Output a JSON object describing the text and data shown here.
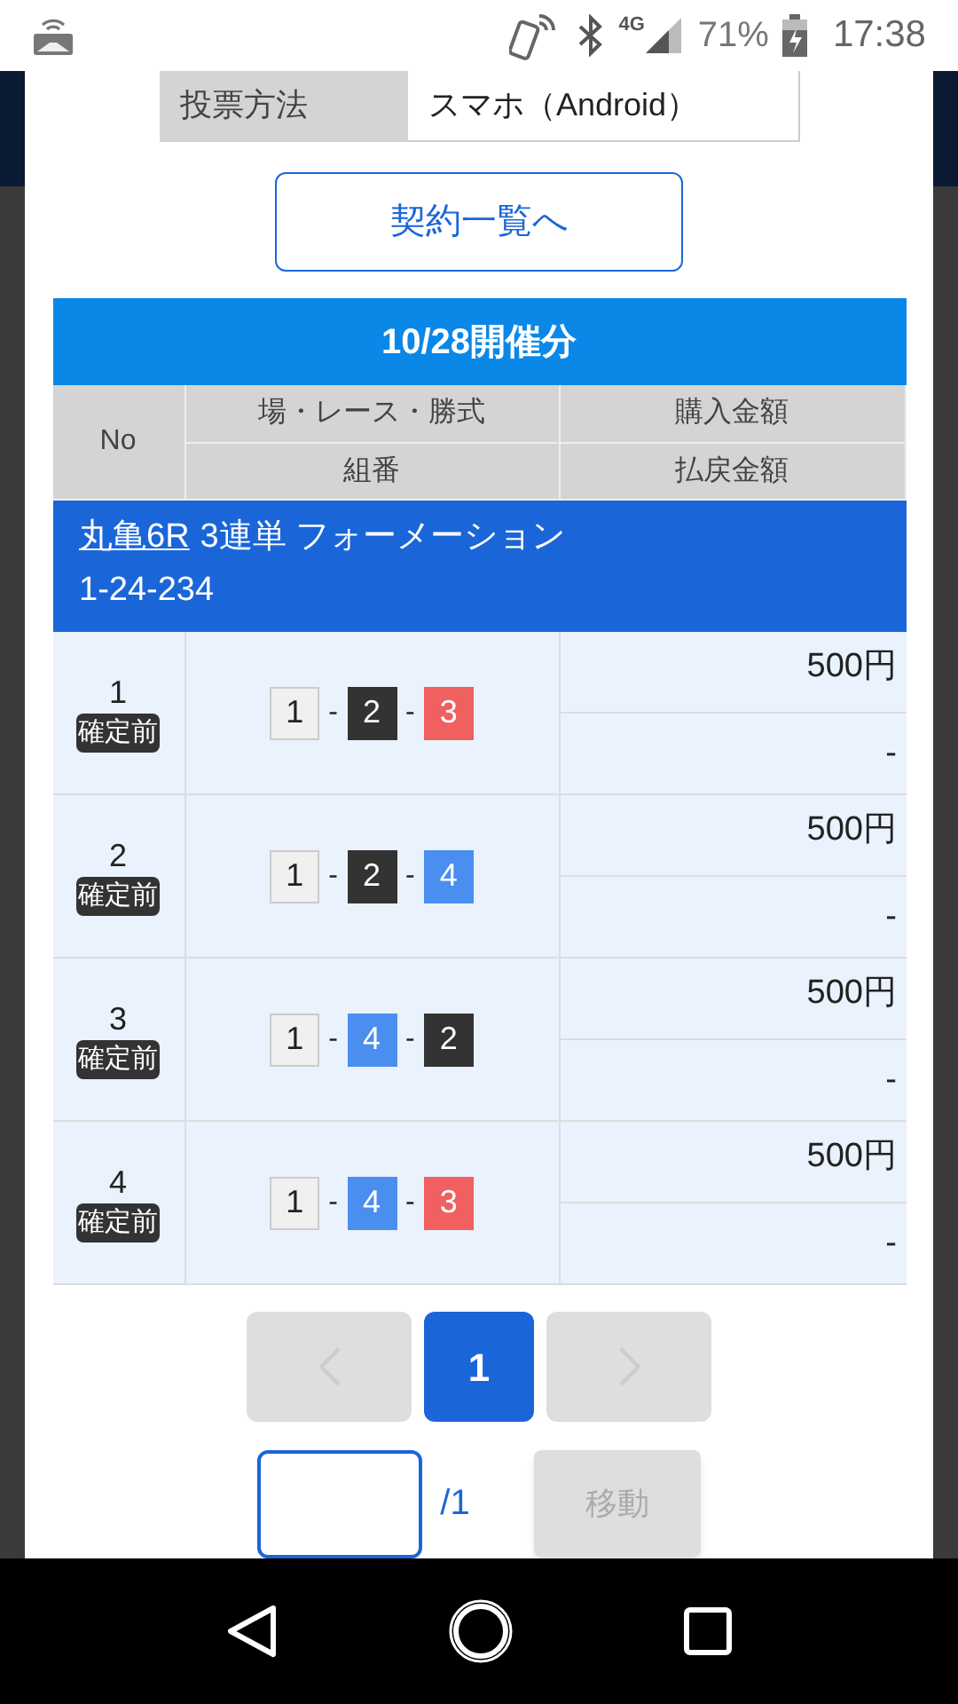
{
  "status_bar": {
    "network": "4G",
    "battery": "71%",
    "time": "17:38"
  },
  "vote_method": {
    "label": "投票方法",
    "value": "スマホ（Android）"
  },
  "contract_list_button": "契約一覧へ",
  "table": {
    "title": "10/28開催分",
    "columns": {
      "no": "No",
      "race": "場・レース・勝式",
      "combination": "組番",
      "purchase": "購入金額",
      "payout": "払戻金額"
    },
    "group": {
      "venue_race": "丸亀6R",
      "bet_type": "3連単 フォーメーション",
      "pattern": "1-24-234"
    },
    "rows": [
      {
        "no": "1",
        "status": "確定前",
        "numbers": [
          {
            "text": "1",
            "color": "#f0f0f0"
          },
          {
            "text": "2",
            "color": "#333333"
          },
          {
            "text": "3",
            "color": "#f06060"
          }
        ],
        "separators": [
          "-",
          "-"
        ],
        "purchase": "500円",
        "payout": "-"
      },
      {
        "no": "2",
        "status": "確定前",
        "numbers": [
          {
            "text": "1",
            "color": "#f0f0f0"
          },
          {
            "text": "2",
            "color": "#333333"
          },
          {
            "text": "4",
            "color": "#4a8ef0"
          }
        ],
        "separators": [
          "-",
          "-"
        ],
        "purchase": "500円",
        "payout": "-"
      },
      {
        "no": "3",
        "status": "確定前",
        "numbers": [
          {
            "text": "1",
            "color": "#f0f0f0"
          },
          {
            "text": "4",
            "color": "#4a8ef0"
          },
          {
            "text": "2",
            "color": "#333333"
          }
        ],
        "separators": [
          "-",
          "-"
        ],
        "purchase": "500円",
        "payout": "-"
      },
      {
        "no": "4",
        "status": "確定前",
        "numbers": [
          {
            "text": "1",
            "color": "#f0f0f0"
          },
          {
            "text": "4",
            "color": "#4a8ef0"
          },
          {
            "text": "3",
            "color": "#f06060"
          }
        ],
        "separators": [
          "-",
          "-"
        ],
        "purchase": "500円",
        "payout": "-"
      }
    ]
  },
  "pagination": {
    "prev_disabled": true,
    "pages": [
      {
        "label": "1",
        "selected": true
      }
    ],
    "next_disabled": true
  },
  "goto": {
    "total": "/1",
    "button": "移動",
    "button_disabled": true
  }
}
